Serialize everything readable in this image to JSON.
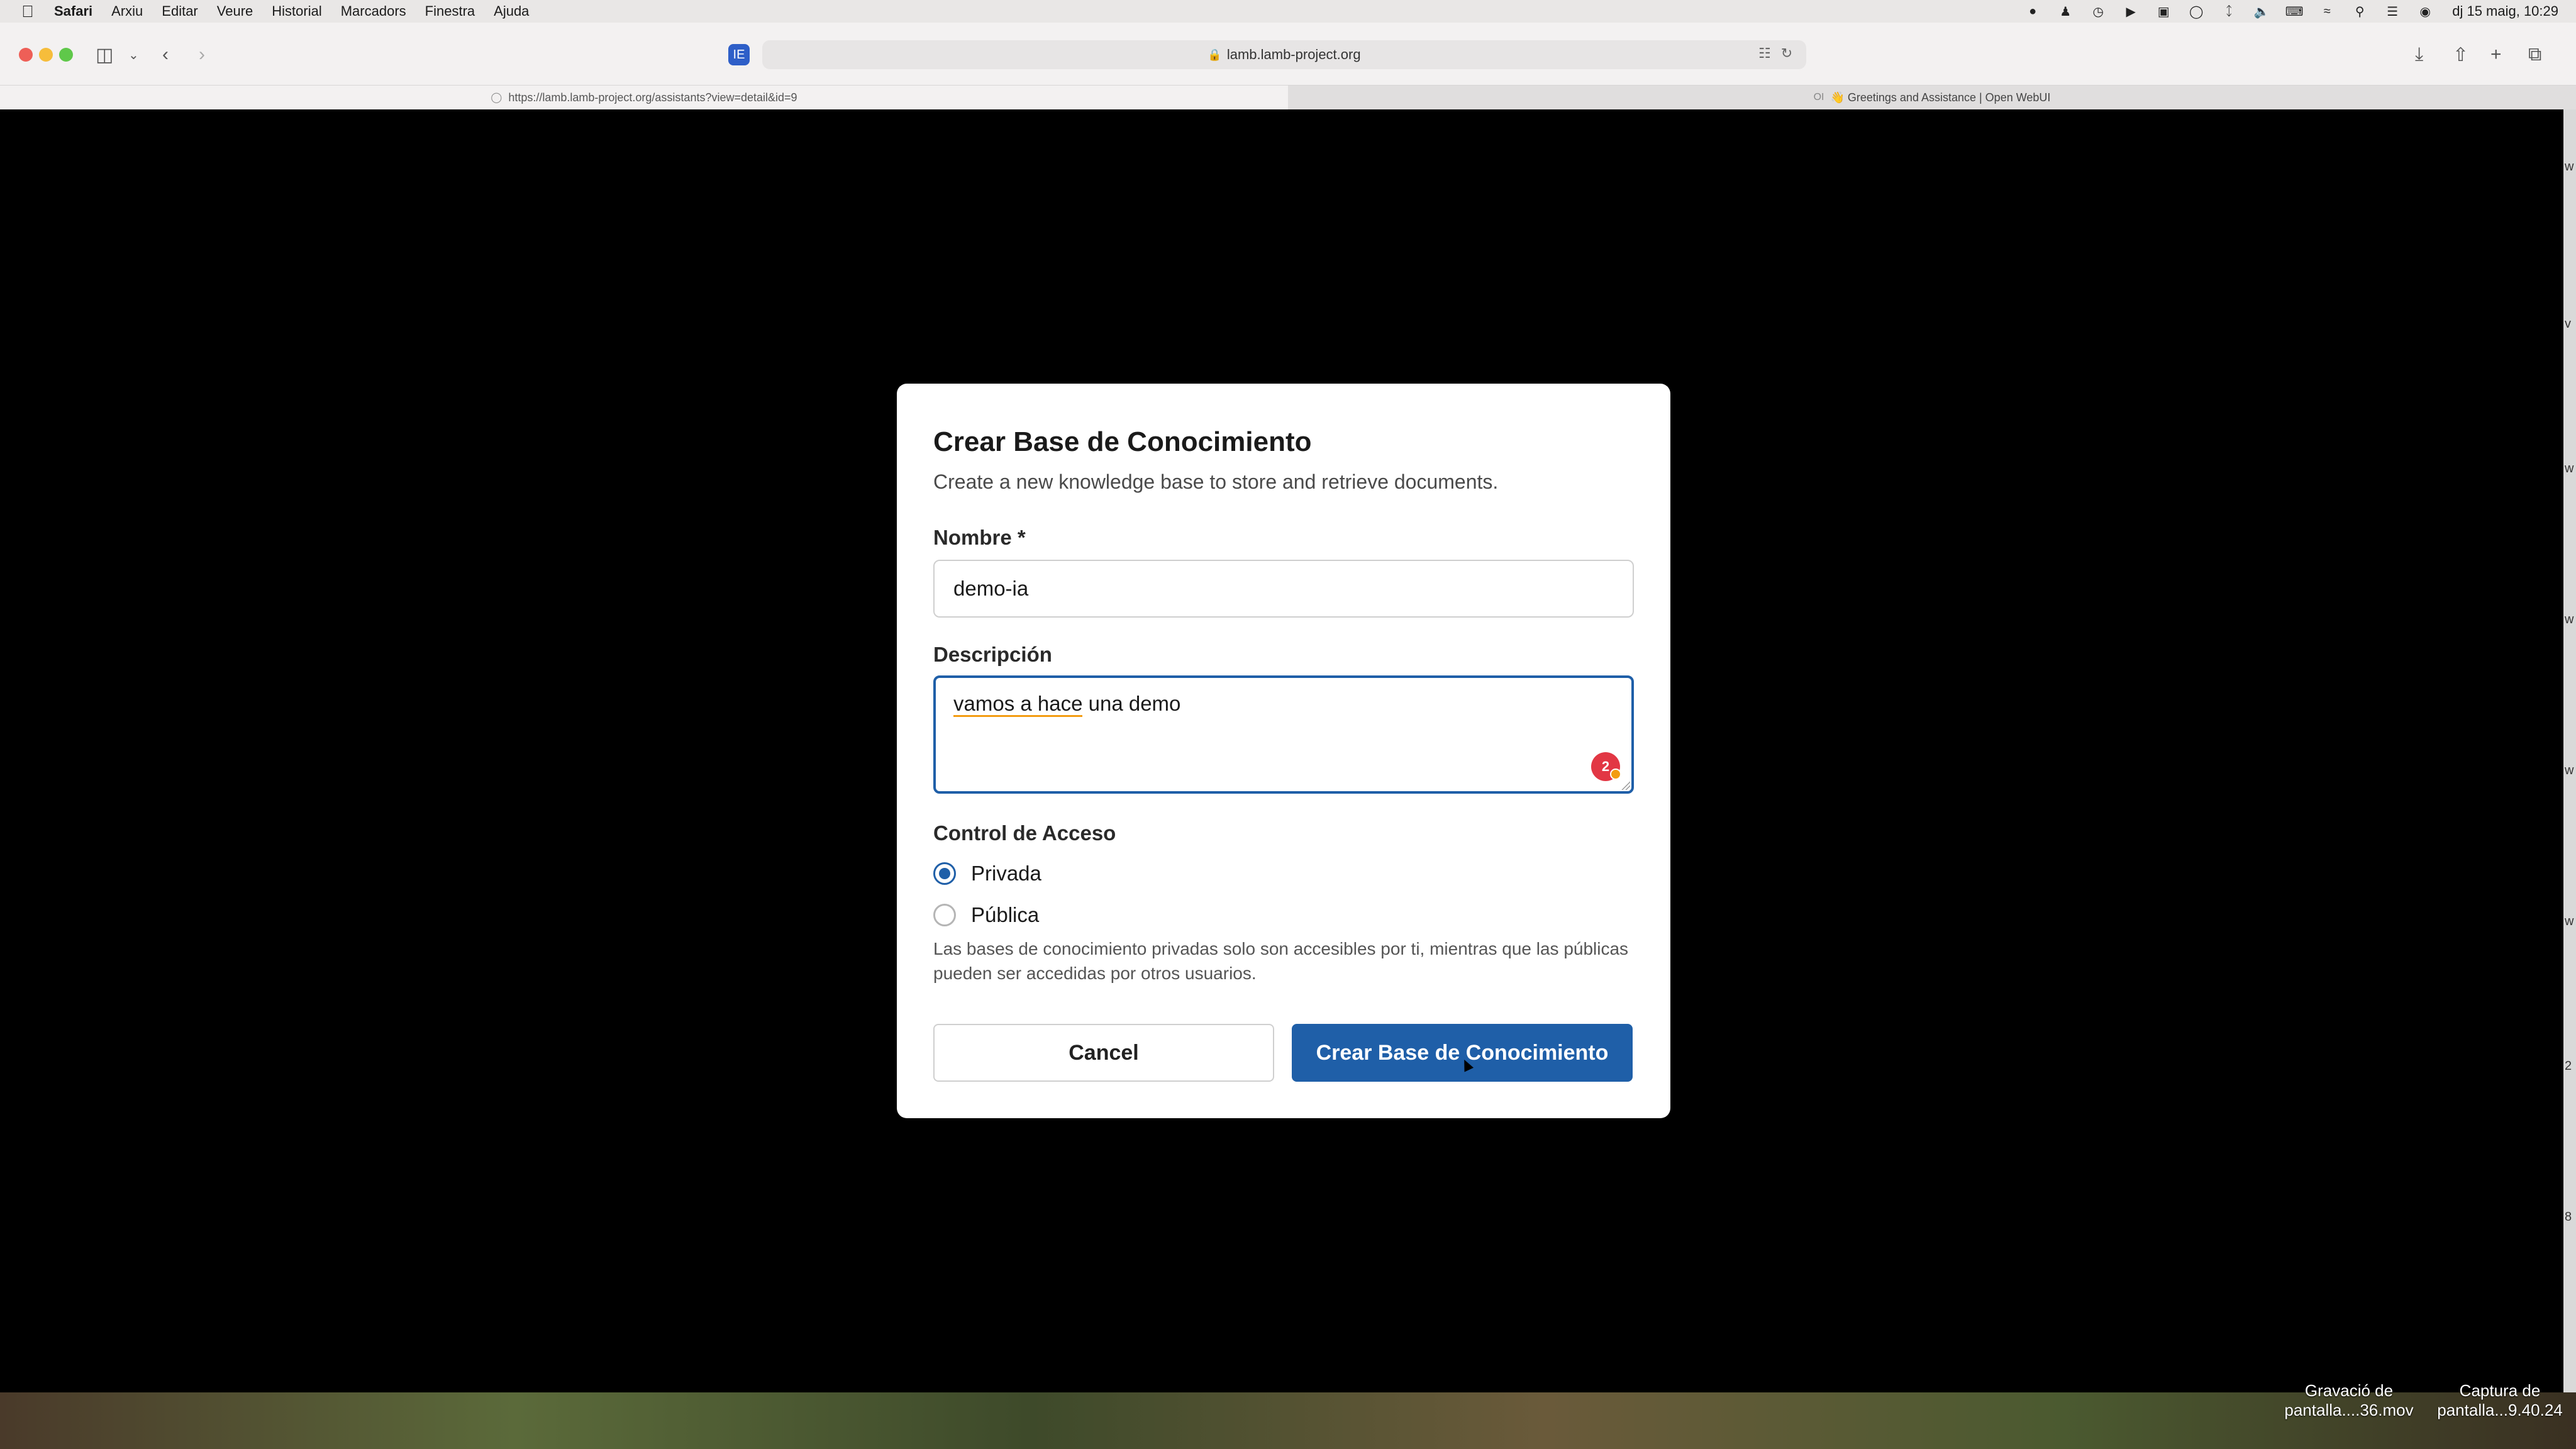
{
  "menubar": {
    "app_name": "Safari",
    "items": [
      "Arxiu",
      "Editar",
      "Veure",
      "Historial",
      "Marcadors",
      "Finestra",
      "Ajuda"
    ],
    "clock": "dj 15 maig, 10:29"
  },
  "browser": {
    "address": "lamb.lamb-project.org",
    "extension_badge": "IE",
    "tabs": [
      {
        "label": "https://lamb.lamb-project.org/assistants?view=detail&id=9",
        "active": true
      },
      {
        "label": "👋 Greetings and Assistance | Open WebUI",
        "active": false
      }
    ]
  },
  "modal": {
    "title": "Crear Base de Conocimiento",
    "subtitle": "Create a new knowledge base to store and retrieve documents.",
    "name_label": "Nombre *",
    "name_value": "demo-ia",
    "description_label": "Descripción",
    "description_value_parts": [
      "vamos a hace",
      " una demo"
    ],
    "grammar_count": "2",
    "access_label": "Control de Acceso",
    "access_options": [
      {
        "label": "Privada",
        "checked": true
      },
      {
        "label": "Pública",
        "checked": false
      }
    ],
    "access_help": "Las bases de conocimiento privadas solo son accesibles por ti, mientras que las públicas pueden ser accedidas por otros usuarios.",
    "cancel_label": "Cancel",
    "create_label": "Crear Base de Conocimiento"
  },
  "desktop": {
    "files": [
      "Gravació de pantalla....36.mov",
      "Captura de pantalla...9.40.24"
    ]
  },
  "right_strip": [
    "w",
    "v",
    "w",
    "w",
    "w",
    "w",
    "2",
    "8"
  ]
}
